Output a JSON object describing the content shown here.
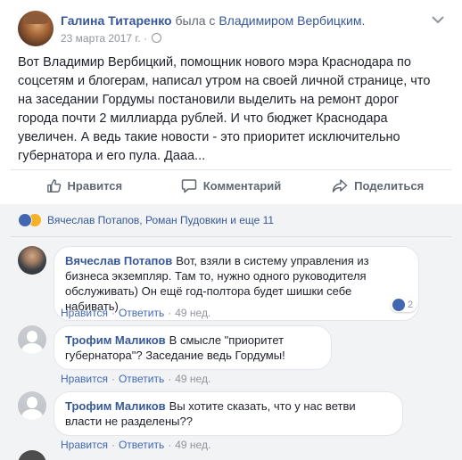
{
  "post": {
    "author": "Галина Титаренко",
    "with_text": "была с",
    "tagged": "Владимиром Вербицким.",
    "date": "23 марта 2017 г.",
    "body": "Вот Владимир Вербицкий, помощник нового мэра Краснодара по соцсетям и блогерам, написал утром на своей личной странице, что на заседании Гордумы постановили выделить на ремонт дорог города почти 2 миллиарда рублей. И что бюджет Краснодара увеличен. А ведь такие новости - это приоритет исключительно губернатора и его пула. Дааа..."
  },
  "actions": {
    "like": "Нравится",
    "comment": "Комментарий",
    "share": "Поделиться"
  },
  "reactions": {
    "names": "Вячеслав Потапов, Роман Пудовкин и еще 11"
  },
  "comments": [
    {
      "name": "Вячеслав Потапов",
      "text": "Вот, взяли в систему управления из бизнеса экземпляр. Там то, нужно одного руководителя обслуживать) Он ещё год-полтора будет шишки себе набивать)",
      "like": "Нравится",
      "reply": "Ответить",
      "time": "49 нед.",
      "reaction_count": "2"
    },
    {
      "name": "Трофим Маликов",
      "text": "В смысле \"приоритет губернатора\"? Заседание ведь Гордумы!",
      "like": "Нравится",
      "reply": "Ответить",
      "time": "49 нед."
    },
    {
      "name": "Трофим Маликов",
      "text": "Вы хотите сказать, что у нас ветви власти не разделены??",
      "like": "Нравится",
      "reply": "Ответить",
      "time": "49 нед."
    }
  ],
  "colors": {
    "link": "#365899",
    "action": "#4267b2",
    "meta": "#90949c",
    "background": "#f2f3f5"
  },
  "icons": {
    "menu": "chevron-down-icon",
    "privacy": "globe-icon",
    "like": "thumbs-up-icon",
    "comment": "speech-bubble-icon",
    "share": "share-arrow-icon"
  }
}
